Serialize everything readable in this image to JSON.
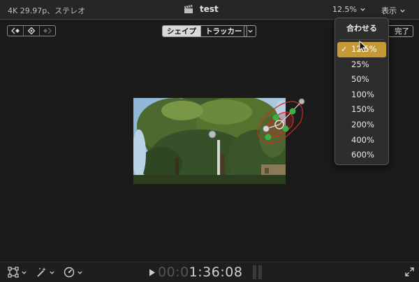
{
  "topbar": {
    "format_label": "4K 29.97p、ステレオ",
    "project_title": "test",
    "zoom_label": "12.5%",
    "view_label": "表示"
  },
  "mask_toolbar": {
    "shape_label": "シェイプ",
    "tracker_label": "トラッカー",
    "done_label": "完了"
  },
  "zoom_menu": {
    "fit_label": "合わせる",
    "items": [
      "12.5%",
      "25%",
      "50%",
      "100%",
      "150%",
      "200%",
      "400%",
      "600%"
    ],
    "selected": "12.5%"
  },
  "bottombar": {
    "timecode_dim": "00:0",
    "timecode_bright": "1:36:08"
  },
  "colors": {
    "menu_highlight": "#c59a36",
    "accent_line": "#3d3aa6",
    "mask_red": "#d62828",
    "handle_green": "#3cb043"
  },
  "icons": [
    "clapper-icon",
    "chevron-down-icon",
    "keyframe-prev-icon",
    "keyframe-add-icon",
    "keyframe-next-icon",
    "transform-icon",
    "magic-wand-icon",
    "speed-icon",
    "play-icon",
    "expand-icon",
    "pointer-cursor-icon"
  ]
}
